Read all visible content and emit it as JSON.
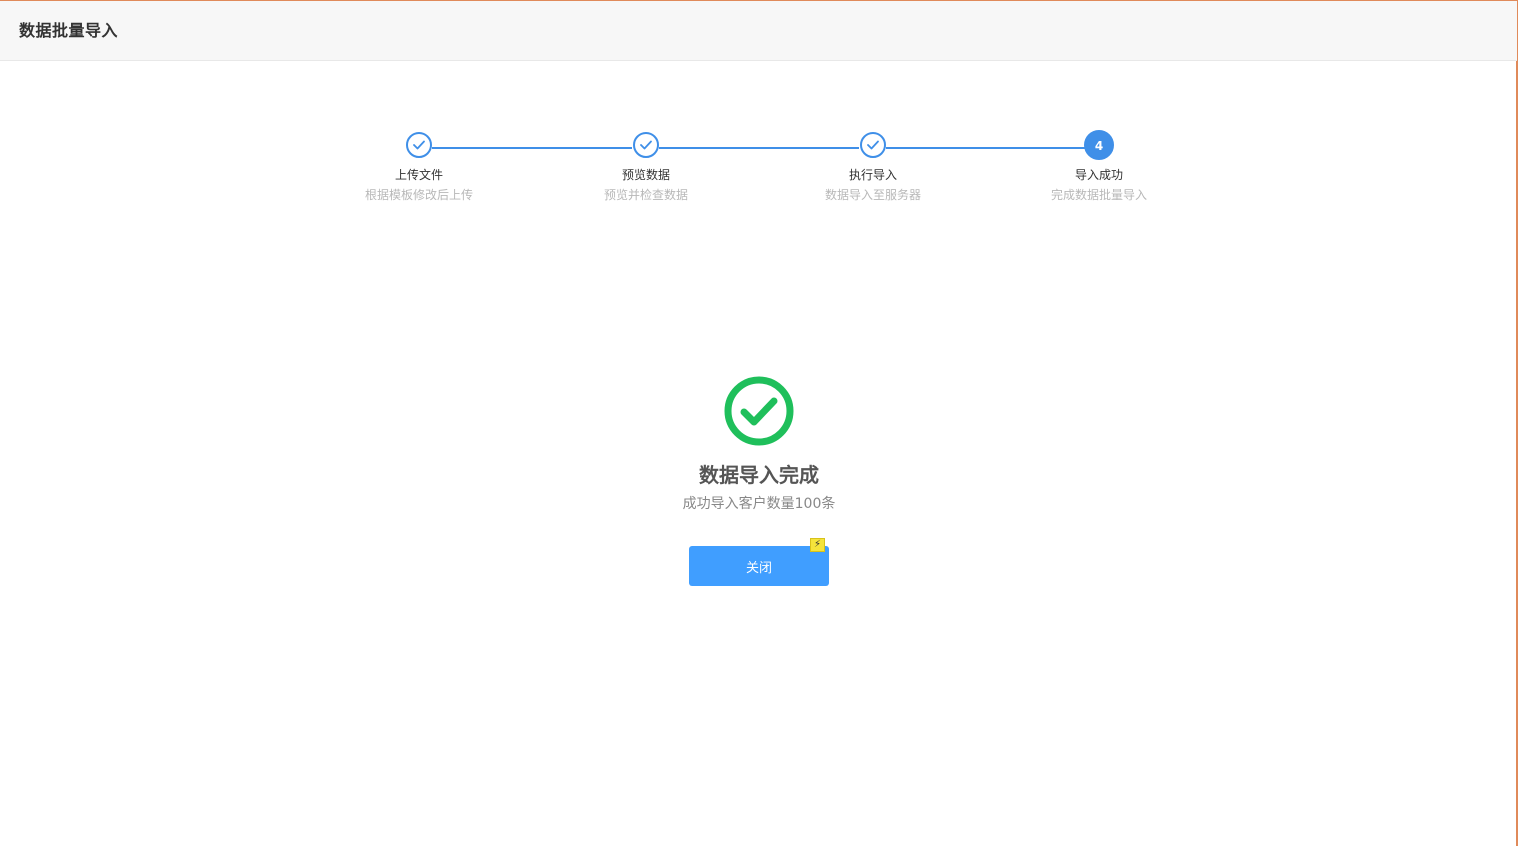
{
  "header": {
    "title": "数据批量导入"
  },
  "steps": [
    {
      "title": "上传文件",
      "desc": "根据模板修改后上传",
      "status": "done"
    },
    {
      "title": "预览数据",
      "desc": "预览并检查数据",
      "status": "done"
    },
    {
      "title": "执行导入",
      "desc": "数据导入至服务器",
      "status": "done"
    },
    {
      "title": "导入成功",
      "desc": "完成数据批量导入",
      "status": "active",
      "number": "4"
    }
  ],
  "result": {
    "icon": "check-circle-icon",
    "title": "数据导入完成",
    "subtitle": "成功导入客户数量100条"
  },
  "actions": {
    "close_label": "关闭"
  },
  "colors": {
    "primary": "#409eff",
    "step_line": "#3f8fe8",
    "success": "#1fbf5b"
  }
}
